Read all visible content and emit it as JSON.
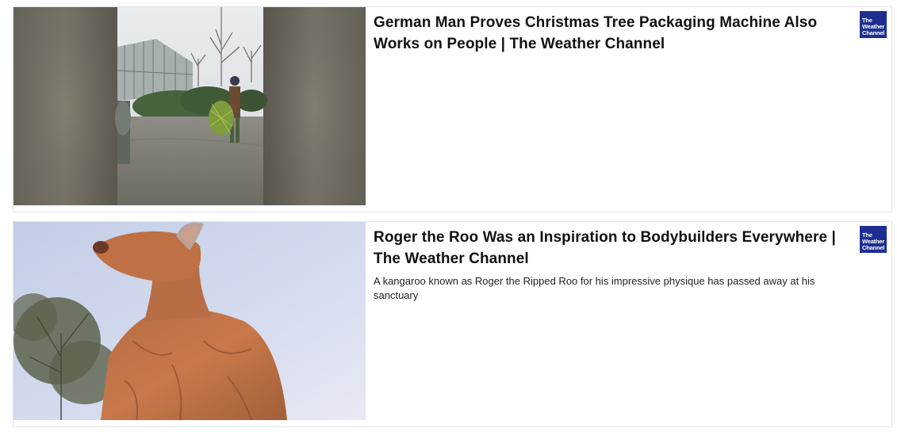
{
  "articles": [
    {
      "headline": "German Man Proves Christmas Tree Packaging Machine Also Works on People | The Weather Channel",
      "summary": "",
      "publisher_logo_lines": [
        "The",
        "Weather",
        "Channel"
      ],
      "image": "man-with-netted-tree-at-garden-center"
    },
    {
      "headline": "Roger the Roo Was an Inspiration to Bodybuilders Everywhere | The Weather Channel",
      "summary": "A kangaroo known as Roger the Ripped Roo for his impressive physique has passed away at his sanctuary",
      "publisher_logo_lines": [
        "The",
        "Weather",
        "Channel"
      ],
      "image": "muscular-kangaroo-against-sky"
    }
  ],
  "colors": {
    "publisher_logo_bg": "#1d2f8f",
    "headline_text": "#111111",
    "card_border": "#e4e4e4"
  }
}
